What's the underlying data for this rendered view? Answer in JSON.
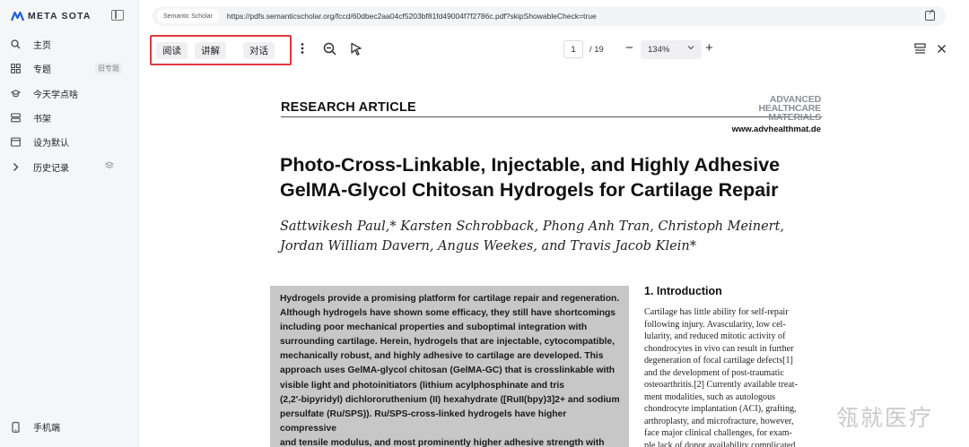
{
  "brand": {
    "name": "META SOTA"
  },
  "sidebar": {
    "items": [
      {
        "label": "主页",
        "icon": "search-icon"
      },
      {
        "label": "专题",
        "icon": "grid-icon",
        "badge": "旧专题"
      },
      {
        "label": "今天学点啥",
        "icon": "graduation-cap-icon"
      },
      {
        "label": "书架",
        "icon": "bookshelf-icon"
      },
      {
        "label": "设为默认",
        "icon": "browser-window-icon"
      },
      {
        "label": "历史记录",
        "icon": "chevron-right-icon",
        "trailing_icon": "layers-icon"
      }
    ],
    "mobile_label": "手机端"
  },
  "urlbar": {
    "source": "Semantic Scholar",
    "url": "https://pdfs.semanticscholar.org/fccd/60dbec2aa04cf5203bf81fd49004f7f2786c.pdf?skipShowableCheck=true"
  },
  "toolbar": {
    "read_label": "阅读",
    "explain_label": "讲解",
    "chat_label": "对话",
    "page_current": "1",
    "page_total": "/ 19",
    "zoom": "134%"
  },
  "paper": {
    "article_type": "RESEARCH ARTICLE",
    "journal_logo_line1": "ADVANCED",
    "journal_logo_line2": "HEALTHCARE",
    "journal_logo_line3": "MATERIALS",
    "journal_url": "www.advhealthmat.de",
    "title_line1": "Photo-Cross-Linkable, Injectable, and Highly Adhesive",
    "title_line2": "GelMA-Glycol Chitosan Hydrogels for Cartilage Repair",
    "authors_line1": "Sattwikesh Paul,* Karsten Schrobback, Phong Anh Tran, Christoph Meinert,",
    "authors_line2": "Jordan William Davern, Angus Weekes, and Travis Jacob Klein*",
    "abstract": "Hydrogels provide a promising platform for cartilage repair and regeneration.\nAlthough hydrogels have shown some efficacy, they still have shortcomings\nincluding poor mechanical properties and suboptimal integration with\nsurrounding cartilage. Herein, hydrogels that are injectable, cytocompatible,\nmechanically robust, and highly adhesive to cartilage are developed. This\napproach uses GelMA-glycol chitosan (GelMA-GC) that is crosslinkable with\nvisible light and photoinitiators (lithium acylphosphinate and tris\n(2,2′-bipyridyl) dichlororuthenium (II) hexahydrate ([RuII(bpy)3]2+ and sodium\npersulfate (Ru/SPS)). Ru/SPS-cross-linked hydrogels have higher compressive\nand tensile modulus, and most prominently higher adhesive strength with\ncartilage, which also depends on inclusion of GC. Tensile and push-out tests",
    "intro_heading": "1. Introduction",
    "intro_text": "Cartilage has little ability for self-repair\nfollowing injury. Avascularity, low cel-\nlularity, and reduced mitotic activity of\nchondrocytes in vivo can result in further\ndegeneration of focal cartilage defects[1]\nand the development of post-traumatic\nosteoarthritis.[2] Currently available treat-\nment modalities, such as autologous\nchondrocyte implantation (ACI), grafting,\narthroplasty, and microfracture, however,\nface major clinical challenges, for exam-\nple lack of donor availability complicated"
  },
  "watermark": "瓴就医疗",
  "colors": {
    "highlight_border": "#e0383e",
    "abstract_bg": "#c7c7c7",
    "sidebar_bg": "#f5f6f8"
  }
}
